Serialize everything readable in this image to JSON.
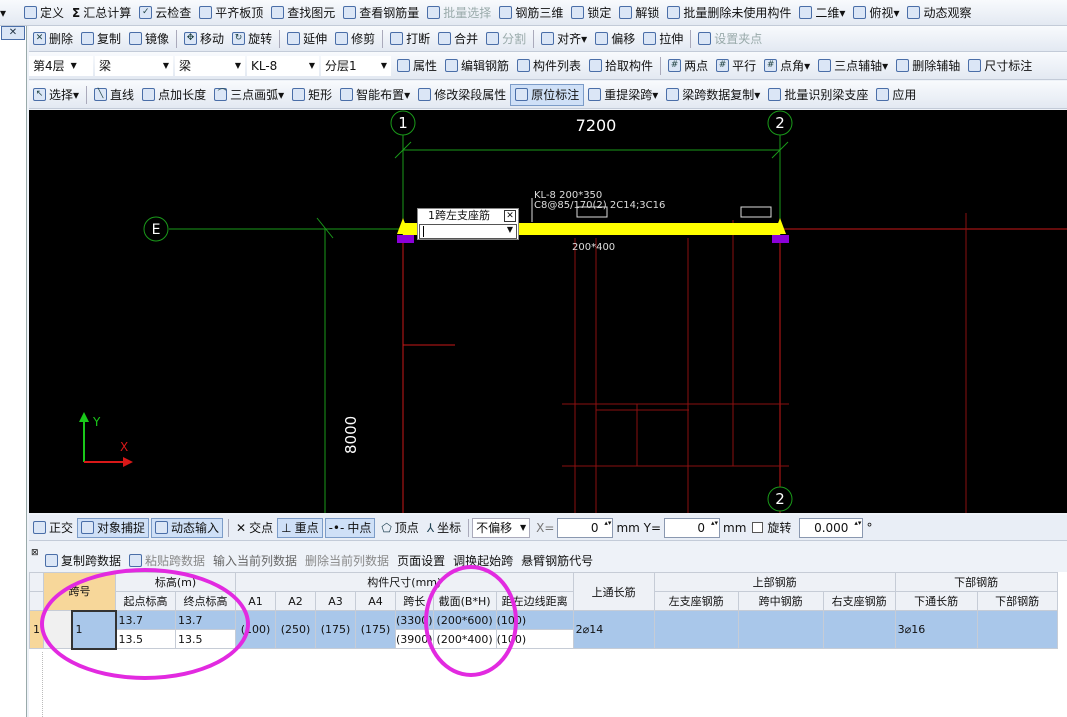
{
  "toolbar1": {
    "items": [
      "定义",
      "汇总计算",
      "云检查",
      "平齐板顶",
      "查找图元",
      "查看钢筋量",
      "批量选择",
      "钢筋三维",
      "锁定",
      "解锁",
      "批量删除未使用构件",
      "二维",
      "俯视",
      "动态观察"
    ]
  },
  "toolbar2": {
    "items": [
      "删除",
      "复制",
      "镜像",
      "移动",
      "旋转",
      "延伸",
      "修剪",
      "打断",
      "合并",
      "分割",
      "对齐",
      "偏移",
      "拉伸",
      "设置夹点"
    ]
  },
  "toolbar3": {
    "floor": "第4层",
    "type1": "梁",
    "type2": "梁",
    "member": "KL-8",
    "sublayer": "分层1",
    "items": [
      "属性",
      "编辑钢筋",
      "构件列表",
      "拾取构件",
      "两点",
      "平行",
      "点角",
      "三点辅轴",
      "删除辅轴",
      "尺寸标注"
    ]
  },
  "toolbar4": {
    "items": [
      "选择",
      "直线",
      "点加长度",
      "三点画弧",
      "矩形",
      "智能布置",
      "修改梁段属性",
      "原位标注",
      "重提梁跨",
      "梁跨数据复制",
      "批量识别梁支座",
      "应用"
    ]
  },
  "canvas": {
    "axis_1": "1",
    "axis_2": "2",
    "axis_2b": "2",
    "axis_e": "E",
    "dim_top": "7200",
    "dim_left": "8000",
    "beam_label_1": "KL-8 200*350",
    "beam_label_2": "C8@85/170(2) 2C14;3C16",
    "section_label": "200*400",
    "popup_title": "1跨左支座筋",
    "ucs_y": "Y",
    "ucs_x": "X"
  },
  "snapbar": {
    "ortho": "正交",
    "osnap": "对象捕捉",
    "dyn": "动态输入",
    "intersect": "交点",
    "midpoint_heavy": "重点",
    "midpoint": "中点",
    "vertex": "顶点",
    "coord": "坐标",
    "offset": "不偏移",
    "x_label": "X=",
    "x_val": "0",
    "y_label": "mm Y=",
    "y_val": "0",
    "mm": "mm",
    "rotate": "旋转",
    "rot_val": "0.000",
    "deg": "°"
  },
  "tabletool": {
    "items": [
      "复制跨数据",
      "粘贴跨数据",
      "输入当前列数据",
      "删除当前列数据",
      "页面设置",
      "调换起始跨",
      "悬臂钢筋代号"
    ]
  },
  "grid": {
    "h_span": "跨号",
    "h_elev": "标高(m)",
    "h_start": "起点标高",
    "h_end": "终点标高",
    "h_dims": "构件尺寸(mm)",
    "h_a1": "A1",
    "h_a2": "A2",
    "h_a3": "A3",
    "h_a4": "A4",
    "h_spanlen": "跨长",
    "h_section": "截面(B*H)",
    "h_edge": "距左边线距离",
    "h_top_long": "上通长筋",
    "h_top": "上部钢筋",
    "h_left": "左支座钢筋",
    "h_mid": "跨中钢筋",
    "h_right": "右支座钢筋",
    "h_bot": "下部钢筋",
    "h_bot_long": "下通长筋",
    "h_bot_rebar": "下部钢筋",
    "row_no": "1",
    "span_no": "1",
    "start_1": "13.7",
    "end_1": "13.7",
    "start_2": "13.5",
    "end_2": "13.5",
    "a1": "(100)",
    "a2": "(250)",
    "a3": "(175)",
    "a4": "(175)",
    "len_1": "(3300)",
    "len_2": "(3900)",
    "sec_1": "(200*600)",
    "sec_2": "(200*400)",
    "edge_1": "(100)",
    "edge_2": "(100)",
    "top_long": "2⌀14",
    "bot_long": "3⌀16"
  }
}
